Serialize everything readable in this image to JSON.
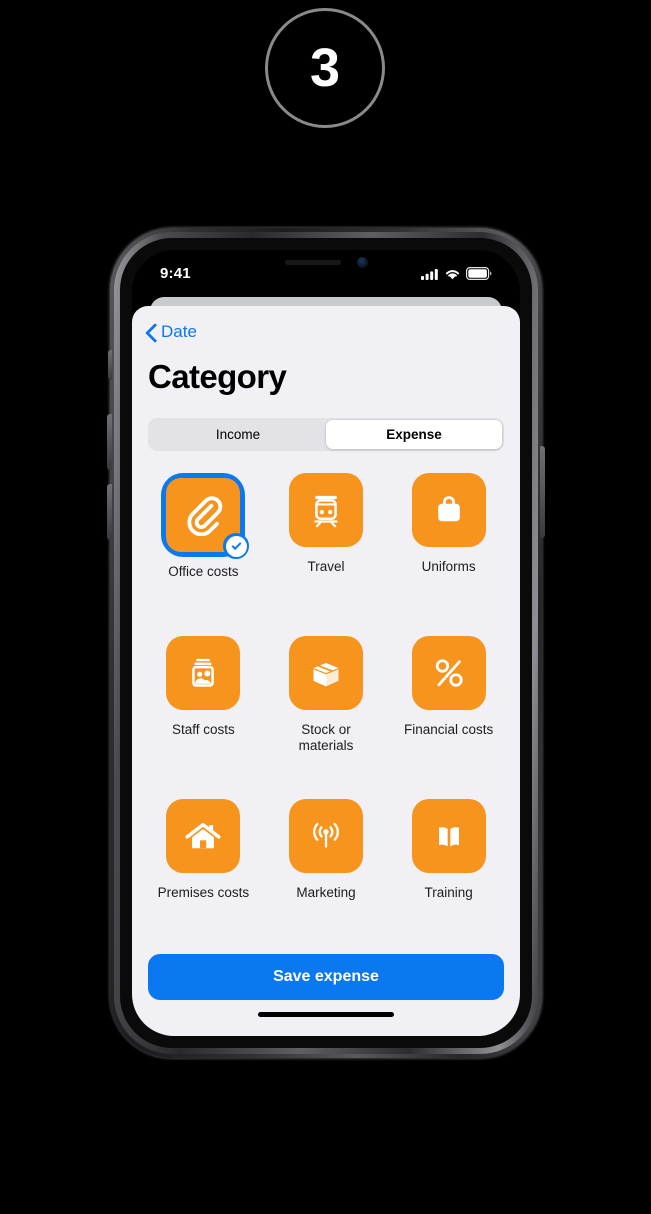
{
  "step": {
    "number": "3"
  },
  "status_bar": {
    "time": "9:41",
    "icons": [
      "cellular-signal-icon",
      "wifi-icon",
      "battery-icon"
    ]
  },
  "nav": {
    "back_label": "Date",
    "back_icon": "chevron-left-icon",
    "accent_color": "#0a78f0"
  },
  "header": {
    "title": "Category"
  },
  "segmented_control": {
    "options": [
      {
        "label": "Income",
        "selected": false
      },
      {
        "label": "Expense",
        "selected": true
      }
    ]
  },
  "categories": {
    "tile_color": "#f7941d",
    "selected_ring_color": "#0a78f0",
    "items": [
      {
        "label": "Office costs",
        "icon": "paperclip-icon",
        "selected": true
      },
      {
        "label": "Travel",
        "icon": "train-icon",
        "selected": false
      },
      {
        "label": "Uniforms",
        "icon": "apron-bag-icon",
        "selected": false
      },
      {
        "label": "Staff costs",
        "icon": "people-icon",
        "selected": false
      },
      {
        "label": "Stock or\nmaterials",
        "icon": "box-icon",
        "selected": false
      },
      {
        "label": "Financial costs",
        "icon": "percent-icon",
        "selected": false
      },
      {
        "label": "Premises costs",
        "icon": "house-icon",
        "selected": false
      },
      {
        "label": "Marketing",
        "icon": "broadcast-icon",
        "selected": false
      },
      {
        "label": "Training",
        "icon": "open-book-icon",
        "selected": false
      }
    ]
  },
  "footer": {
    "save_label": "Save expense",
    "save_color": "#0a78f0",
    "home_indicator": "home-indicator"
  }
}
